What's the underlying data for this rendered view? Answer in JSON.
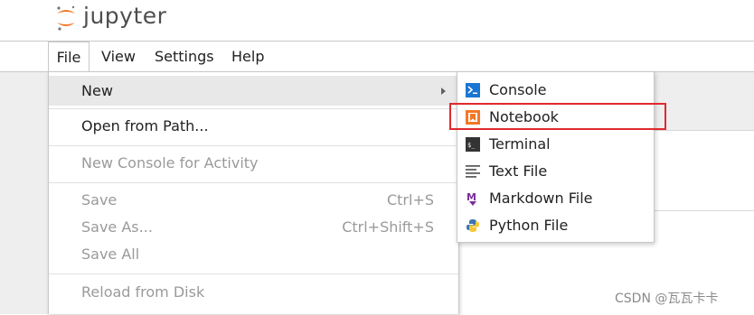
{
  "app": {
    "logo_text": "jupyter"
  },
  "menubar": {
    "items": [
      {
        "label": "File"
      },
      {
        "label": "View"
      },
      {
        "label": "Settings"
      },
      {
        "label": "Help"
      }
    ]
  },
  "file_menu": {
    "new": {
      "label": "New"
    },
    "open_from_path": {
      "label": "Open from Path..."
    },
    "new_console_for_activity": {
      "label": "New Console for Activity"
    },
    "save": {
      "label": "Save",
      "shortcut": "Ctrl+S"
    },
    "save_as": {
      "label": "Save As...",
      "shortcut": "Ctrl+Shift+S"
    },
    "save_all": {
      "label": "Save All"
    },
    "reload_from_disk": {
      "label": "Reload from Disk"
    }
  },
  "new_submenu": {
    "items": [
      {
        "label": "Console",
        "icon": "console-icon"
      },
      {
        "label": "Notebook",
        "icon": "notebook-icon"
      },
      {
        "label": "Terminal",
        "icon": "terminal-icon"
      },
      {
        "label": "Text File",
        "icon": "text-file-icon"
      },
      {
        "label": "Markdown File",
        "icon": "markdown-icon"
      },
      {
        "label": "Python File",
        "icon": "python-icon"
      }
    ]
  },
  "colors": {
    "accent_highlight": "#e0292e",
    "jupyter_orange": "#f37726",
    "console_blue": "#1976d2",
    "markdown_purple": "#7b2d9a"
  },
  "watermark": "CSDN @瓦瓦卡卡"
}
